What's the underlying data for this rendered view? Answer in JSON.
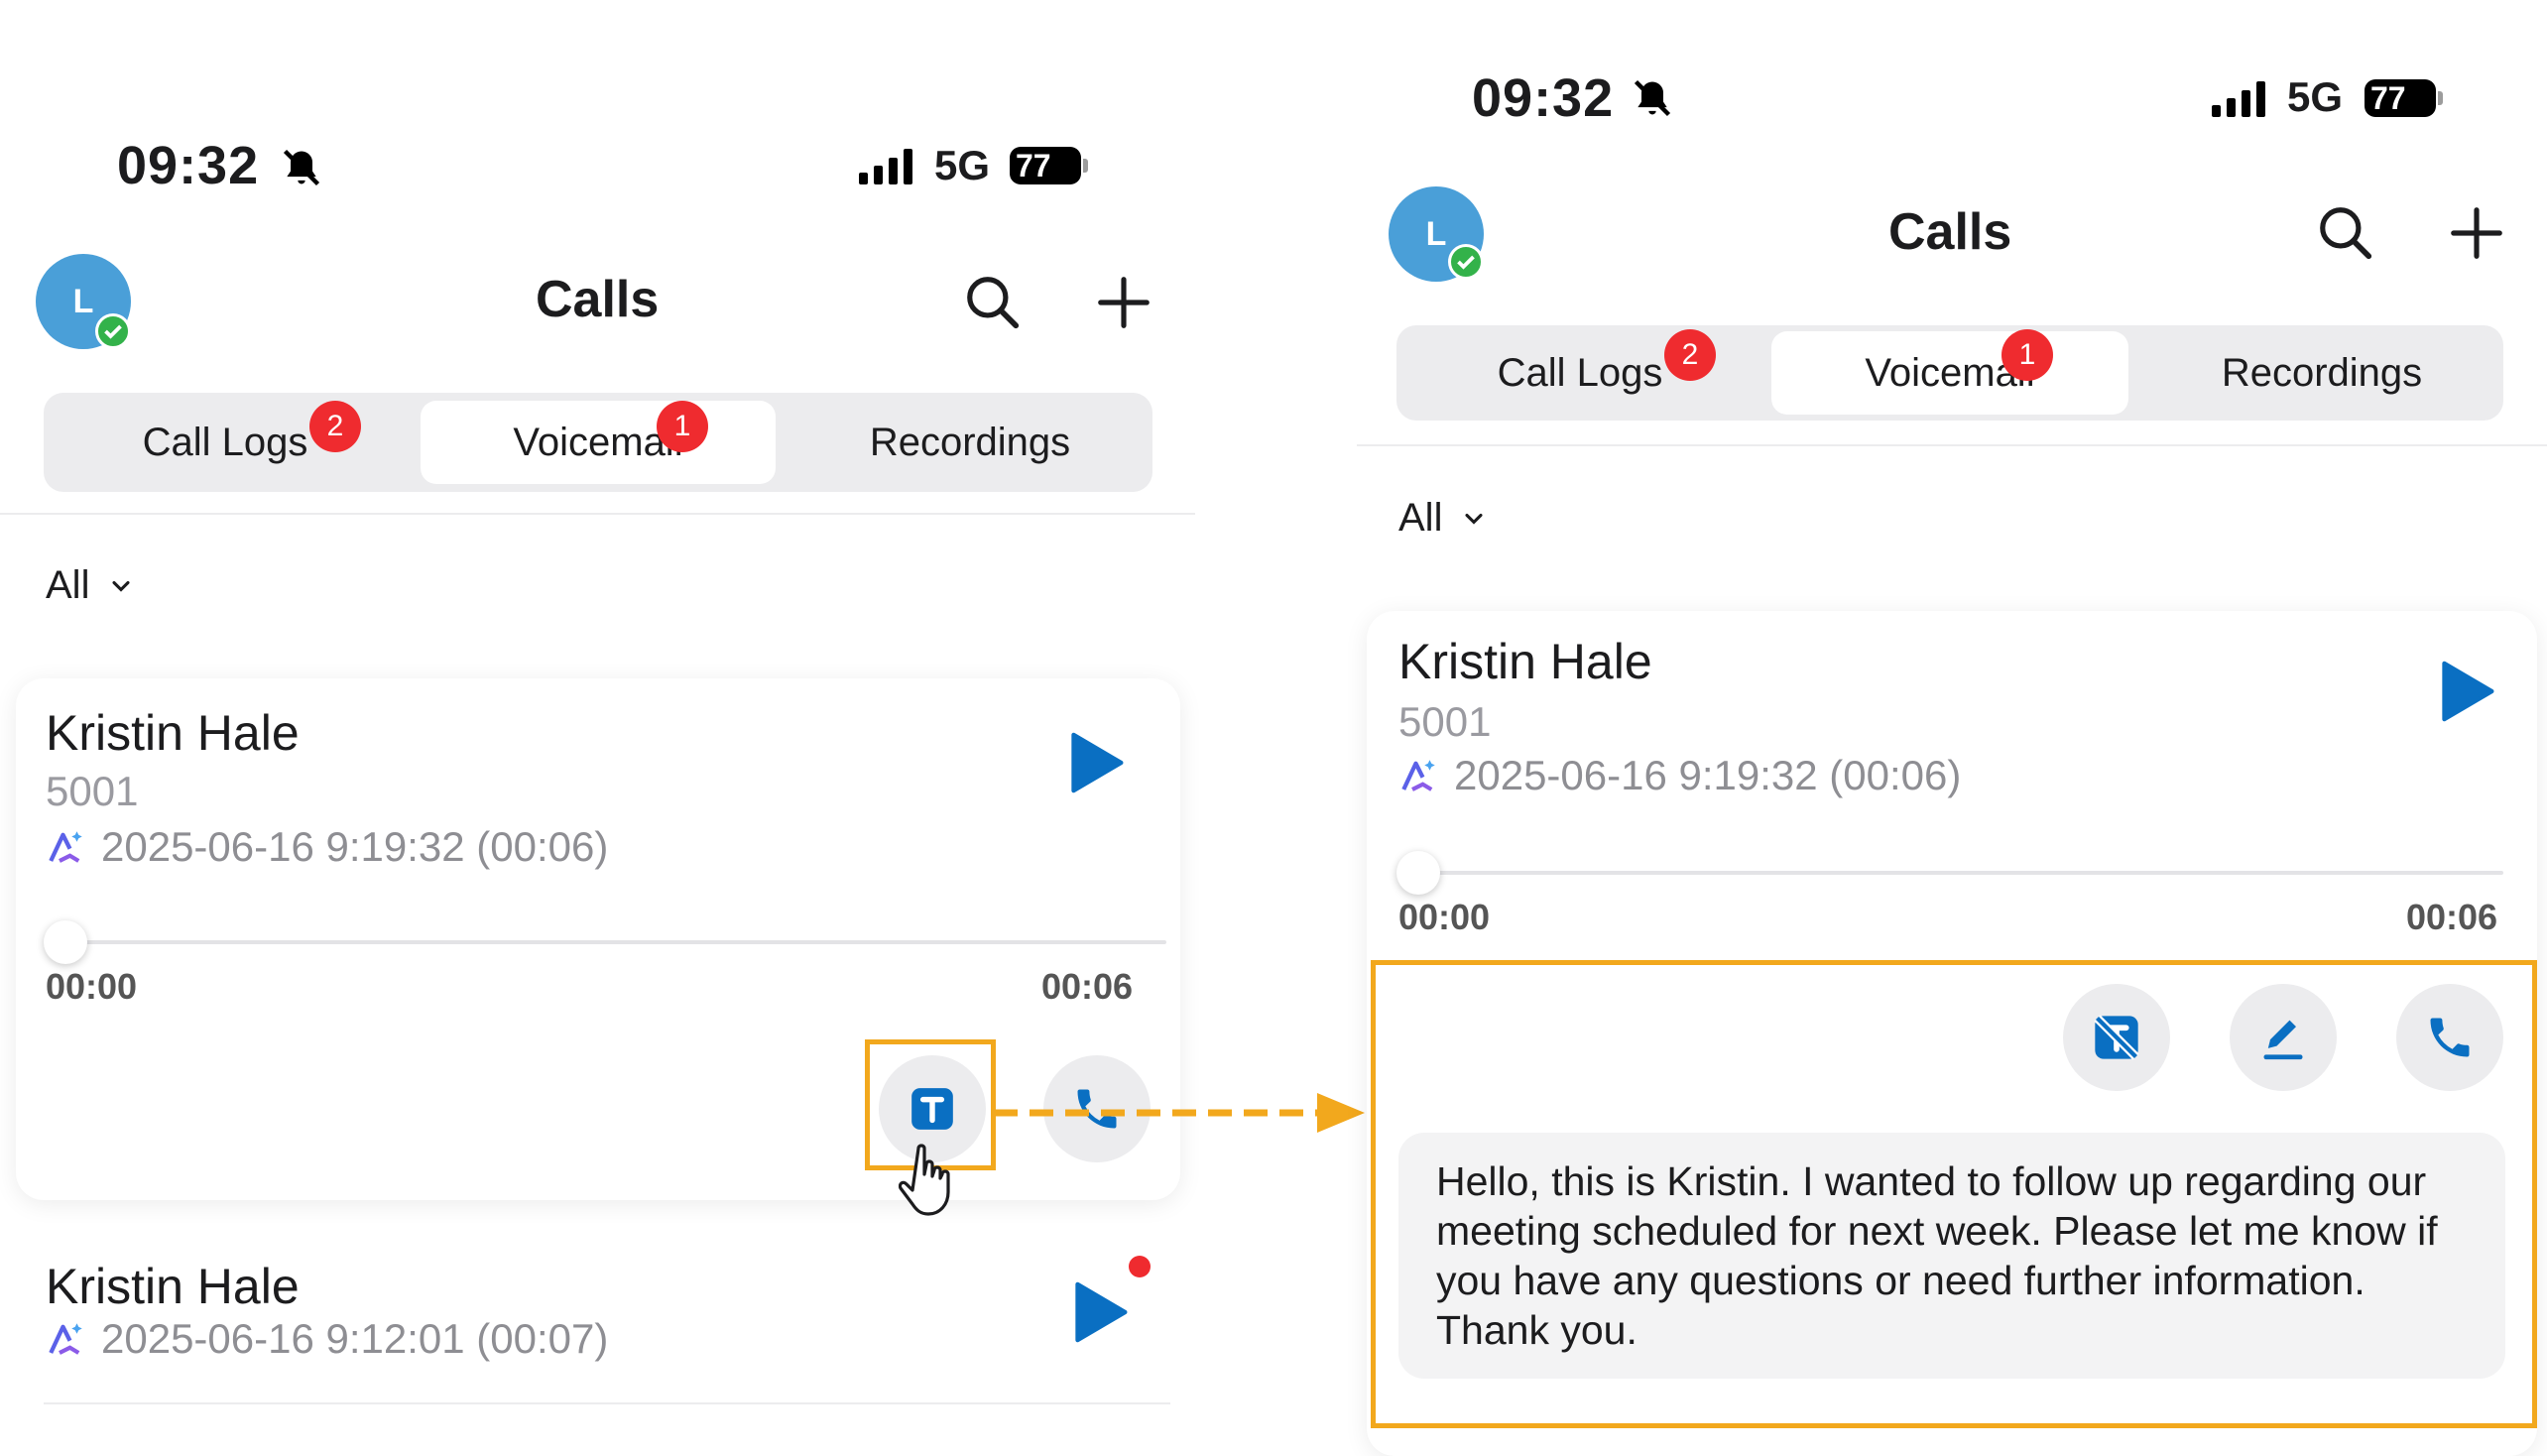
{
  "left": {
    "status_bar": {
      "time": "09:32",
      "network": "5G",
      "battery": "77"
    },
    "header": {
      "avatar_initial": "L",
      "title": "Calls"
    },
    "tabs": [
      {
        "label": "Call Logs",
        "badge": "2"
      },
      {
        "label": "Voicemail",
        "badge": "1",
        "active": true
      },
      {
        "label": "Recordings"
      }
    ],
    "filter": {
      "label": "All"
    },
    "voicemails": [
      {
        "name": "Kristin Hale",
        "number": "5001",
        "datetime": "2025-06-16 9:19:32 (00:06)",
        "elapsed": "00:00",
        "duration": "00:06"
      },
      {
        "name": "Kristin Hale",
        "datetime": "2025-06-16 9:12:01 (00:07)",
        "unread": true
      }
    ]
  },
  "right": {
    "status_bar": {
      "time": "09:32",
      "network": "5G",
      "battery": "77"
    },
    "header": {
      "avatar_initial": "L",
      "title": "Calls"
    },
    "tabs": [
      {
        "label": "Call Logs",
        "badge": "2"
      },
      {
        "label": "Voicemail",
        "badge": "1",
        "active": true
      },
      {
        "label": "Recordings"
      }
    ],
    "filter": {
      "label": "All"
    },
    "voicemail": {
      "name": "Kristin Hale",
      "number": "5001",
      "datetime": "2025-06-16 9:19:32 (00:06)",
      "elapsed": "00:00",
      "duration": "00:06",
      "transcript": "Hello, this is Kristin. I wanted to follow up regarding our meeting scheduled for next week. Please let me know if you have any questions or need further information. Thank you."
    }
  },
  "colors": {
    "accent_blue": "#0a6fc2",
    "highlight": "#f2a81d",
    "badge_red": "#ef2b2f",
    "presence_green": "#33b24a",
    "avatar_blue": "#4a9fd8"
  }
}
